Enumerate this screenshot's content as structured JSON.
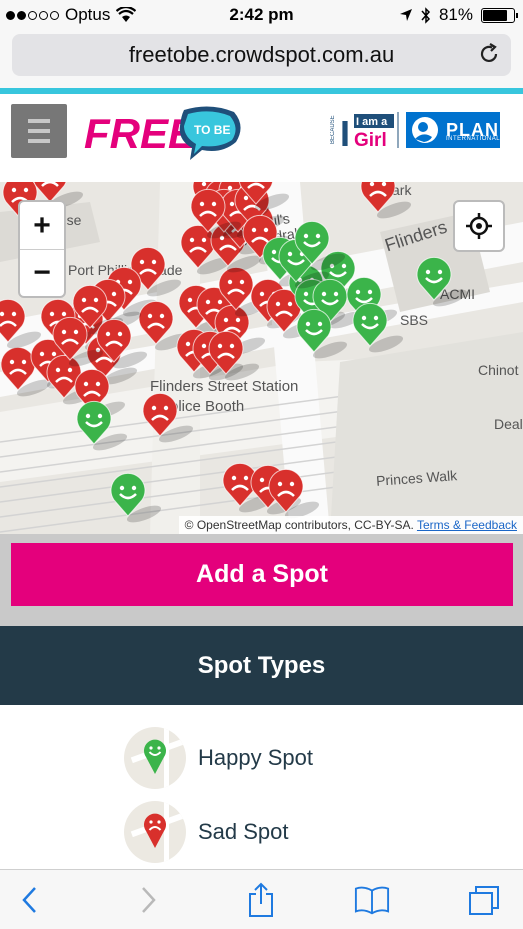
{
  "status": {
    "carrier": "Optus",
    "time": "2:42 pm",
    "battery": "81%",
    "battery_level": 0.81
  },
  "url": {
    "host": "freetobe.crowdspot.com.au"
  },
  "header": {
    "logo_free": "FREE",
    "logo_tobe": "TO BE",
    "logo_because": "BECAUSE",
    "logo_iama": "I am a",
    "logo_girl": "Girl",
    "logo_plan": "PLAN",
    "logo_international": "INTERNATIONAL"
  },
  "map": {
    "labels": [
      "s House",
      "Port Phillip Arcade",
      "St Paul's Cathedral",
      "Flinders",
      "ACMI",
      "SBS",
      "Chinot",
      "Flinders Street Station",
      "Police Booth",
      "Deal",
      "Princes Walk",
      "ark"
    ],
    "zoom_in": "+",
    "zoom_out": "−",
    "attribution_text": "© OpenStreetMap contributors, CC-BY-SA.",
    "attribution_link": "Terms & Feedback",
    "colors": {
      "sad": "#d8302c",
      "happy": "#3bb44a"
    }
  },
  "actions": {
    "add_spot": "Add a Spot"
  },
  "spot_types": {
    "title": "Spot Types",
    "items": [
      {
        "label": "Happy Spot",
        "icon": "happy-pin-icon"
      },
      {
        "label": "Sad Spot",
        "icon": "sad-pin-icon"
      }
    ]
  },
  "colors": {
    "accent": "#e4007c",
    "header": "#233a48",
    "brand_cyan": "#38c6dd"
  }
}
